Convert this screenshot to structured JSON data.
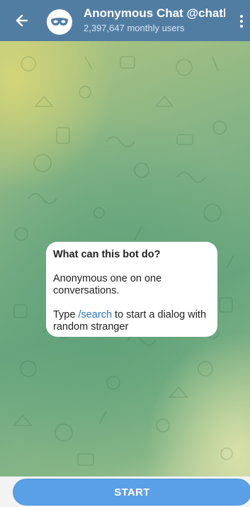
{
  "header": {
    "title": "Anonymous Chat @chatbo",
    "subtitle": "2,397,647 monthly users",
    "back_icon": "arrow-left-icon",
    "avatar_icon": "mask-icon",
    "menu_icon": "more-vertical-icon",
    "background": "#527DA3"
  },
  "bot_info": {
    "title": "What can this bot do?",
    "description": "Anonymous one on one conversations.",
    "type_prefix": "Type ",
    "command": "/search",
    "type_suffix": " to start a dialog with random stranger",
    "command_color": "#2b74c6"
  },
  "footer": {
    "start_label": "START",
    "button_color": "#5aa0e6"
  }
}
